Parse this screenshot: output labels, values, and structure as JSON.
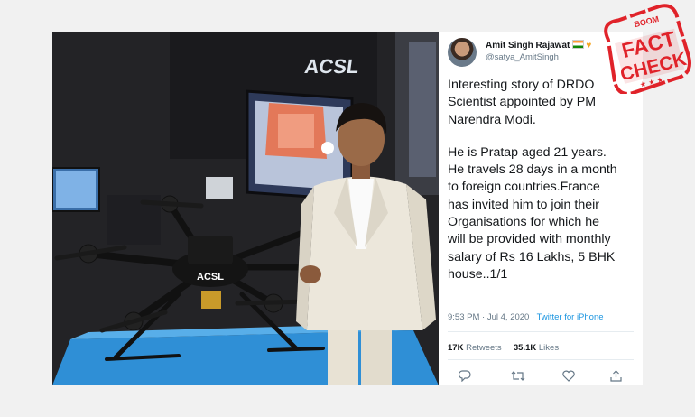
{
  "photo": {
    "drone_marking": "ACSL",
    "booth_sign": "ACSL"
  },
  "tweet": {
    "display_name": "Amit Singh Rajawat",
    "handle": "@satya_AmitSingh",
    "text_lines_1": [
      "Interesting story of DRDO",
      "Scientist appointed by PM",
      "Narendra Modi."
    ],
    "text_lines_2": [
      "He is Pratap aged 21 years.",
      "He travels 28 days in a month",
      "to foreign countries.France",
      "has invited him to join their",
      "Organisations for which he",
      "will be provided with monthly",
      "salary of Rs 16 Lakhs, 5 BHK",
      "house..1/1"
    ],
    "time": "9:53 PM",
    "date": "Jul 4, 2020",
    "source": "Twitter for iPhone",
    "retweets_count": "17K",
    "retweets_label": "Retweets",
    "likes_count": "35.1K",
    "likes_label": "Likes",
    "icons": [
      "reply-icon",
      "retweet-icon",
      "like-icon",
      "share-icon"
    ]
  },
  "stamp": {
    "brand": "BOOM",
    "line1": "FACT",
    "line2": "CHECK",
    "color": "#e0232a"
  }
}
